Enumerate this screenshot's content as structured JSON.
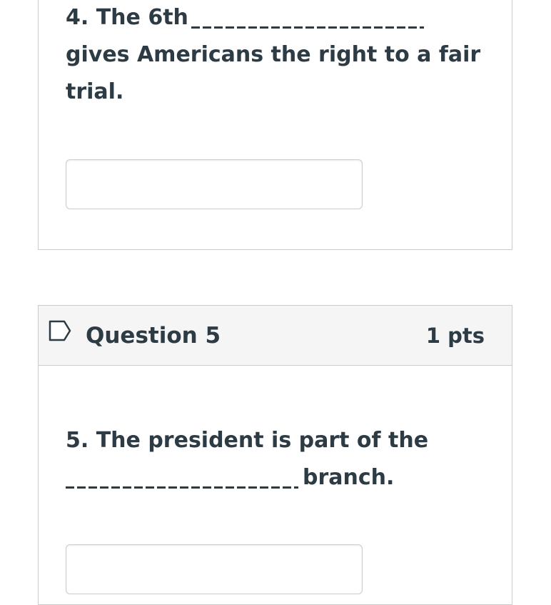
{
  "question4": {
    "text_line1": "4. The 6th",
    "text_line2": "gives Americans the right to a fair",
    "text_line3": "trial.",
    "answer_value": ""
  },
  "question5": {
    "title": "Question 5",
    "points": "1 pts",
    "text_line1": "5. The president is part of the",
    "text_line2": "branch.",
    "answer_value": "",
    "flag_icon": "flag-outline-icon"
  },
  "colors": {
    "text": "#2d3b45",
    "border": "#c7cdd1",
    "header_bg": "#f5f5f5"
  }
}
